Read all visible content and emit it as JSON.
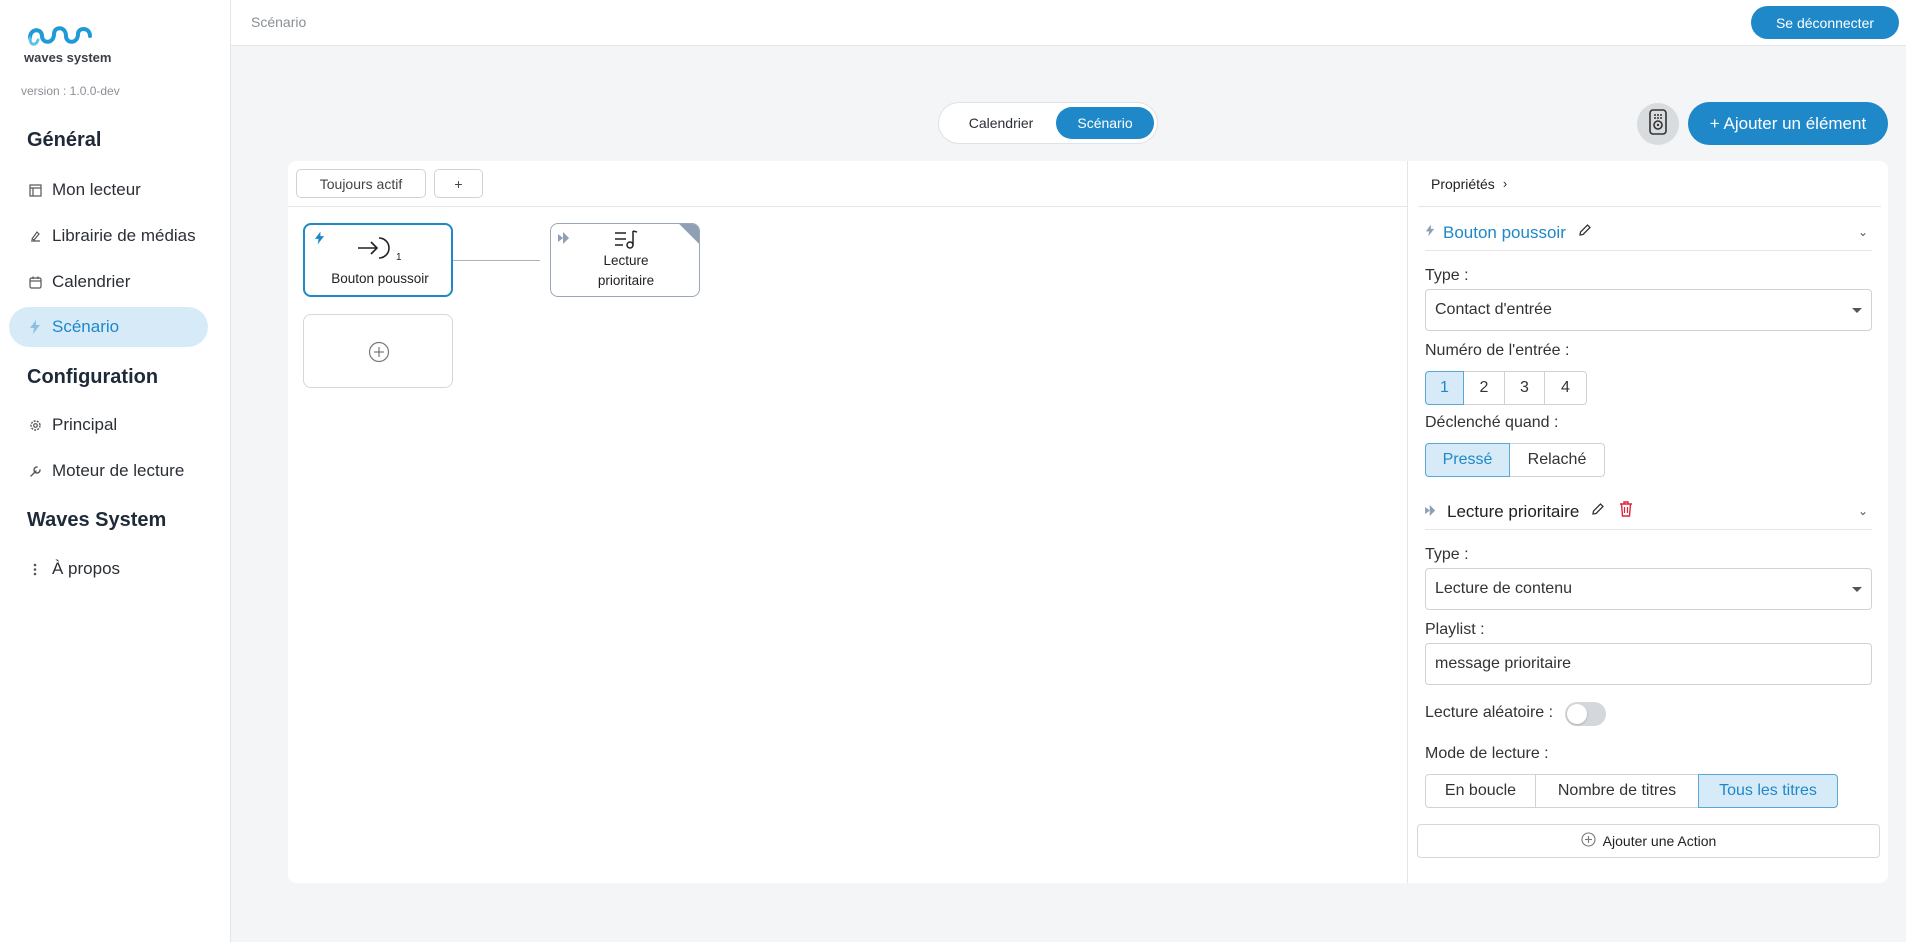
{
  "app": {
    "logo_text": "waves system",
    "version": "version : 1.0.0-dev"
  },
  "sidebar": {
    "sections": [
      {
        "title": "Général"
      },
      {
        "title": "Configuration"
      },
      {
        "title": "Waves System"
      }
    ],
    "items": [
      {
        "label": "Mon lecteur",
        "icon": "player-icon"
      },
      {
        "label": "Librairie de médias",
        "icon": "media-library-icon"
      },
      {
        "label": "Calendrier",
        "icon": "calendar-icon"
      },
      {
        "label": "Scénario",
        "icon": "bolt-icon",
        "active": true
      },
      {
        "label": "Principal",
        "icon": "gear-icon"
      },
      {
        "label": "Moteur de lecture",
        "icon": "wrench-icon"
      },
      {
        "label": "À propos",
        "icon": "dots-vertical-icon"
      }
    ]
  },
  "header": {
    "breadcrumb": "Scénario",
    "logout_label": "Se déconnecter"
  },
  "view_switch": {
    "options": [
      "Calendrier",
      "Scénario"
    ],
    "selected": "Scénario"
  },
  "toolbar": {
    "add_element_label": "+ Ajouter un élément"
  },
  "canvas": {
    "tabs": [
      "Toujours actif",
      "+"
    ],
    "nodes": [
      {
        "label": "Bouton poussoir",
        "icon": "input-contact-icon",
        "badge": "1",
        "selected": true
      },
      {
        "label_line1": "Lecture",
        "label_line2": "prioritaire",
        "icon": "priority-playlist-icon"
      }
    ],
    "add_node": "add-circle-icon"
  },
  "properties": {
    "header": "Propriétés",
    "trigger": {
      "title": "Bouton poussoir",
      "type_label": "Type :",
      "type_value": "Contact d'entrée",
      "input_number_label": "Numéro de l'entrée :",
      "input_numbers": [
        "1",
        "2",
        "3",
        "4"
      ],
      "input_selected": "1",
      "triggered_when_label": "Déclenché quand :",
      "triggered_options": [
        "Pressé",
        "Relaché"
      ],
      "triggered_selected": "Pressé"
    },
    "action": {
      "title": "Lecture prioritaire",
      "type_label": "Type :",
      "type_value": "Lecture de contenu",
      "playlist_label": "Playlist :",
      "playlist_value": "message prioritaire",
      "shuffle_label": "Lecture aléatoire :",
      "shuffle_on": false,
      "mode_label": "Mode de lecture :",
      "mode_options": [
        "En boucle",
        "Nombre de titres",
        "Tous les titres"
      ],
      "mode_selected": "Tous les titres"
    },
    "add_action_label": "Ajouter une Action"
  },
  "colors": {
    "accent": "#1e88c9",
    "accent_light": "#d6ebf7",
    "danger": "#e0243a"
  }
}
